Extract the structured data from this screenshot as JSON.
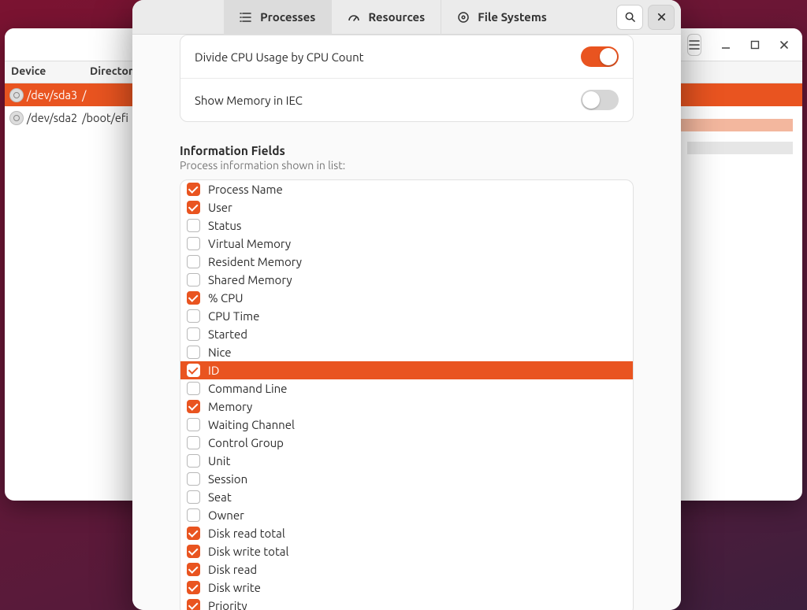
{
  "fs_window": {
    "headers": {
      "device": "Device",
      "directory": "Directory"
    },
    "rows": [
      {
        "device": "/dev/sda3",
        "mount": "/"
      },
      {
        "device": "/dev/sda2",
        "mount": "/boot/efi"
      }
    ]
  },
  "dialog": {
    "tabs": {
      "processes": "Processes",
      "resources": "Resources",
      "filesystems": "File Systems"
    },
    "settings": {
      "divide_cpu": {
        "label": "Divide CPU Usage by CPU Count",
        "on": true
      },
      "mem_iec": {
        "label": "Show Memory in IEC",
        "on": false
      }
    },
    "info_fields": {
      "title": "Information Fields",
      "subtitle": "Process information shown in list:",
      "items": [
        {
          "label": "Process Name",
          "checked": true,
          "highlight": false
        },
        {
          "label": "User",
          "checked": true,
          "highlight": false
        },
        {
          "label": "Status",
          "checked": false,
          "highlight": false
        },
        {
          "label": "Virtual Memory",
          "checked": false,
          "highlight": false
        },
        {
          "label": "Resident Memory",
          "checked": false,
          "highlight": false
        },
        {
          "label": "Shared Memory",
          "checked": false,
          "highlight": false
        },
        {
          "label": "% CPU",
          "checked": true,
          "highlight": false
        },
        {
          "label": "CPU Time",
          "checked": false,
          "highlight": false
        },
        {
          "label": "Started",
          "checked": false,
          "highlight": false
        },
        {
          "label": "Nice",
          "checked": false,
          "highlight": false
        },
        {
          "label": "ID",
          "checked": true,
          "highlight": true
        },
        {
          "label": "Command Line",
          "checked": false,
          "highlight": false
        },
        {
          "label": "Memory",
          "checked": true,
          "highlight": false
        },
        {
          "label": "Waiting Channel",
          "checked": false,
          "highlight": false
        },
        {
          "label": "Control Group",
          "checked": false,
          "highlight": false
        },
        {
          "label": "Unit",
          "checked": false,
          "highlight": false
        },
        {
          "label": "Session",
          "checked": false,
          "highlight": false
        },
        {
          "label": "Seat",
          "checked": false,
          "highlight": false
        },
        {
          "label": "Owner",
          "checked": false,
          "highlight": false
        },
        {
          "label": "Disk read total",
          "checked": true,
          "highlight": false
        },
        {
          "label": "Disk write total",
          "checked": true,
          "highlight": false
        },
        {
          "label": "Disk read",
          "checked": true,
          "highlight": false
        },
        {
          "label": "Disk write",
          "checked": true,
          "highlight": false
        },
        {
          "label": "Priority",
          "checked": true,
          "highlight": false
        }
      ]
    }
  }
}
